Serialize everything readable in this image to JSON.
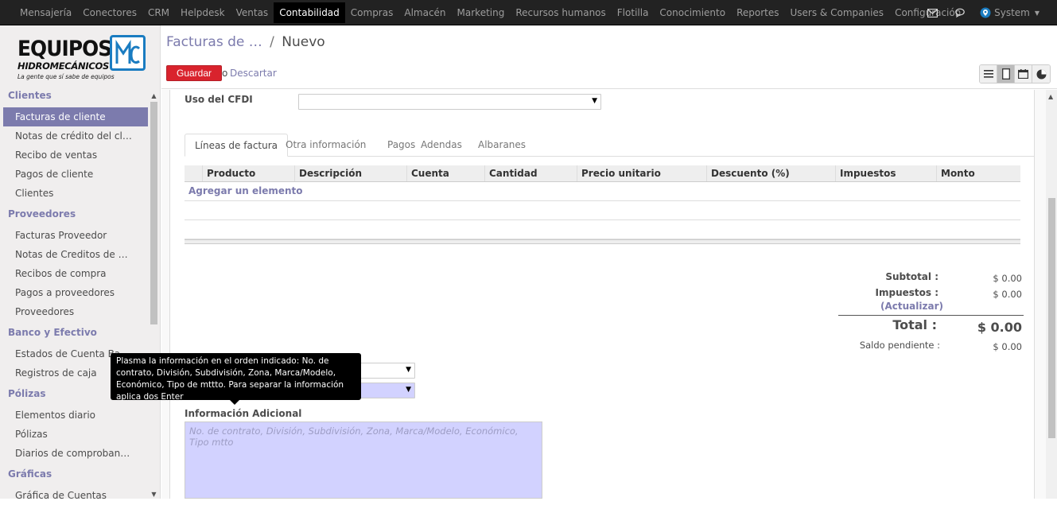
{
  "topnav": {
    "items": [
      "Mensajería",
      "Conectores",
      "CRM",
      "Helpdesk",
      "Ventas",
      "Contabilidad",
      "Compras",
      "Almacén",
      "Marketing",
      "Recursos humanos",
      "Flotilla",
      "Conocimiento",
      "Reportes",
      "Users & Companies",
      "Configuración"
    ],
    "active_index": 5,
    "user": "System",
    "icons": [
      "mail-icon",
      "chat-icon"
    ]
  },
  "logo": {
    "line1": "EQUIPOS",
    "line2": "HIDROMECÁNICOS",
    "tagline": "La gente que sí sabe de equipos",
    "brand_color": "#1a7cc1"
  },
  "sidebar": {
    "sections": [
      {
        "title": "Clientes",
        "items": [
          "Facturas de cliente",
          "Notas de crédito del clie…",
          "Recibo de ventas",
          "Pagos de cliente",
          "Clientes"
        ]
      },
      {
        "title": "Proveedores",
        "items": [
          "Facturas Proveedor",
          "Notas de Creditos de Pr…",
          "Recibos de compra",
          "Pagos a proveedores",
          "Proveedores"
        ]
      },
      {
        "title": "Banco y Efectivo",
        "items": [
          "Estados de Cuenta Ban…",
          "Registros de caja"
        ]
      },
      {
        "title": "Pólizas",
        "items": [
          "Elementos diario",
          "Pólizas",
          "Diarios de comprobantes"
        ]
      },
      {
        "title": "Gráficas",
        "items": [
          "Gráfica de Cuentas"
        ]
      }
    ],
    "active_item": "Facturas de cliente"
  },
  "control": {
    "breadcrumb_parent": "Facturas de …",
    "breadcrumb_sep": "/",
    "breadcrumb_current": "Nuevo",
    "save_label": "Guardar",
    "or_label": "o",
    "discard_label": "Descartar"
  },
  "form": {
    "cfdi_label": "Uso del CFDI",
    "tabs": [
      "Líneas de factura",
      "Otra información",
      "Pagos",
      "Adendas",
      "Albaranes"
    ],
    "active_tab": "Líneas de factura",
    "columns": [
      "Producto",
      "Descripción",
      "Cuenta",
      "Cantidad",
      "Precio unitario",
      "Descuento (%)",
      "Impuestos",
      "Monto"
    ],
    "add_line": "Agregar un elemento",
    "subtotal_label": "Subtotal :",
    "subtotal_value": "$ 0.00",
    "taxes_label": "Impuestos :",
    "taxes_value": "$ 0.00",
    "update_label": "(Actualizar)",
    "total_label": "Total :",
    "total_value": "$ 0.00",
    "residual_label": "Saldo pendiente :",
    "residual_value": "$ 0.00",
    "info_label": "Información Adicional",
    "info_placeholder": "No. de contrato, División, Subdivisión, Zona, Marca/Modelo, Económico, Tipo mtto"
  },
  "tooltip": {
    "text": "Plasma la información en el orden indicado: No. de contrato, División, Subdivisión, Zona, Marca/Modelo, Económico, Tipo de mttto. Para separar la información aplica dos Enter"
  },
  "colors": {
    "accent": "#7c7bad",
    "save": "#d9232d",
    "topbar": "#222222",
    "required_field": "#d2d2ff"
  }
}
